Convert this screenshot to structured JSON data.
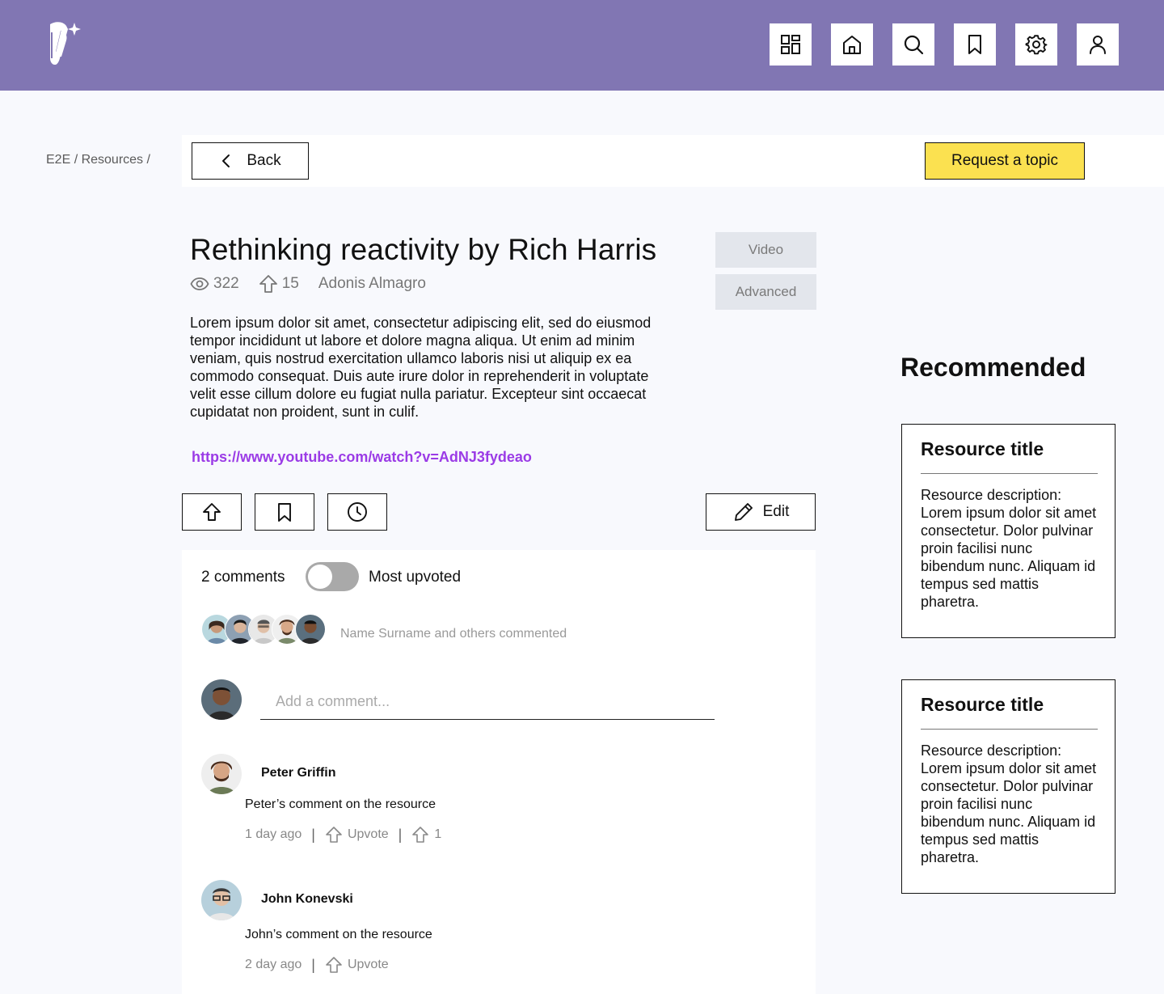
{
  "header": {
    "logo": "app-logo",
    "nav_icons": [
      "dashboard-icon",
      "home-icon",
      "search-icon",
      "bookmark-icon",
      "settings-icon",
      "user-icon"
    ]
  },
  "breadcrumb": "E2E / Resources /",
  "toolbar": {
    "back_label": "Back",
    "request_label": "Request a topic"
  },
  "resource": {
    "title": "Rethinking reactivity by Rich Harris",
    "views": "322",
    "upvotes": "15",
    "author": "Adonis Almagro",
    "tags": [
      "Video",
      "Advanced"
    ],
    "description": "Lorem ipsum dolor sit amet, consectetur adipiscing elit, sed do eiusmod tempor incididunt ut labore et dolore magna aliqua. Ut enim ad minim veniam, quis nostrud exercitation ullamco laboris nisi ut aliquip ex ea commodo consequat. Duis aute irure dolor in reprehenderit in voluptate velit esse cillum dolore eu fugiat nulla pariatur. Excepteur sint occaecat cupidatat non proident, sunt in culif.",
    "link": "https://www.youtube.com/watch?v=AdNJ3fydeao",
    "edit_label": "Edit"
  },
  "comments": {
    "count_label": "2 comments",
    "sort_label": "Most upvoted",
    "sort_toggle_on": false,
    "commenters_text": "Name Surname and others commented",
    "input_placeholder": "Add a comment...",
    "items": [
      {
        "name": "Peter Griffin",
        "text": "Peter’s comment on the resource",
        "time": "1 day ago",
        "upvote_label": "Upvote",
        "upvote_count": "1"
      },
      {
        "name": "John Konevski",
        "text": "John’s comment on the resource",
        "time": "2 day ago",
        "upvote_label": "Upvote"
      }
    ]
  },
  "recommended": {
    "heading": "Recommended",
    "cards": [
      {
        "title": "Resource title",
        "description": "Resource description: Lorem ipsum dolor sit amet consectetur. Dolor pulvinar proin facilisi nunc bibendum nunc. Aliquam id tempus sed mattis pharetra."
      },
      {
        "title": "Resource title",
        "description": "Resource description: Lorem ipsum dolor sit amet consectetur. Dolor pulvinar proin facilisi nunc bibendum nunc. Aliquam id tempus sed mattis pharetra."
      }
    ]
  },
  "colors": {
    "header_bg": "#8176b3",
    "accent_yellow": "#fbe150",
    "link": "#9b3be6",
    "tag_bg": "#e3e6ec",
    "page_bg": "#f8f9fd"
  }
}
